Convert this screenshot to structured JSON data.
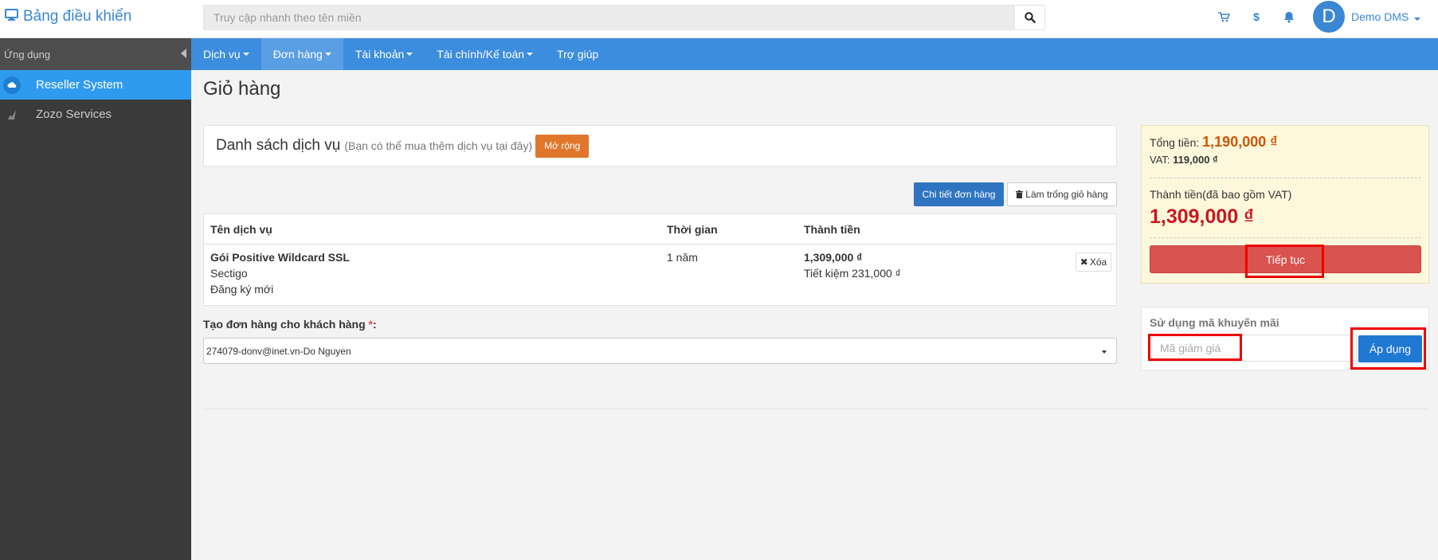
{
  "header": {
    "brand": "Bảng điều khiển",
    "search_placeholder": "Truy cập nhanh theo tên miền",
    "dollar": "$",
    "user_initial": "D",
    "user_name": "Demo DMS"
  },
  "sidebar": {
    "title": "Ứng dụng",
    "items": [
      {
        "label": "Reseller System"
      },
      {
        "label": "Zozo Services"
      }
    ]
  },
  "nav": {
    "items": [
      {
        "label": "Dịch vụ"
      },
      {
        "label": "Đơn hàng"
      },
      {
        "label": "Tài khoản"
      },
      {
        "label": "Tài chính/Kế toán"
      },
      {
        "label": "Trợ giúp"
      }
    ]
  },
  "page": {
    "title": "Giỏ hàng"
  },
  "services": {
    "title": "Danh sách dịch vụ",
    "subtitle": "(Bạn có thể mua thêm dịch vụ tại đây)",
    "expand_label": "Mở rộng",
    "detail_label": "Chi tiết đơn hàng",
    "clear_label": "Làm trống giỏ hàng"
  },
  "table": {
    "headers": [
      "Tên dịch vụ",
      "Thời gian",
      "Thành tiền"
    ],
    "rows": [
      {
        "name": "Gói Positive Wildcard SSL",
        "vendor": "Sectigo",
        "type": "Đăng ký mới",
        "period": "1 năm",
        "price": "1,309,000 ₫",
        "saving": "Tiết kiệm 231,000 ₫",
        "delete_label": "Xóa"
      }
    ]
  },
  "customer": {
    "label": "Tạo đơn hàng cho khách hàng",
    "required_mark": "*",
    "colon": ":",
    "value": "274079-donv@inet.vn-Do Nguyen"
  },
  "summary": {
    "total_label": "Tổng tiền:",
    "total_value": "1,190,000 ₫",
    "vat_label": "VAT:",
    "vat_value": "119,000 ₫",
    "final_label": "Thành tiền(đã bao gồm VAT)",
    "final_value": "1,309,000 ₫",
    "continue_label": "Tiếp tục"
  },
  "promo": {
    "title": "Sử dụng mã khuyến mãi",
    "placeholder": "Mã giảm giá",
    "apply_label": "Áp dụng"
  },
  "colors": {
    "brand": "#3a87d4",
    "nav": "#3c8dde",
    "danger": "#d9534f",
    "orange": "#e0762c",
    "highlight": "#ee0000"
  }
}
